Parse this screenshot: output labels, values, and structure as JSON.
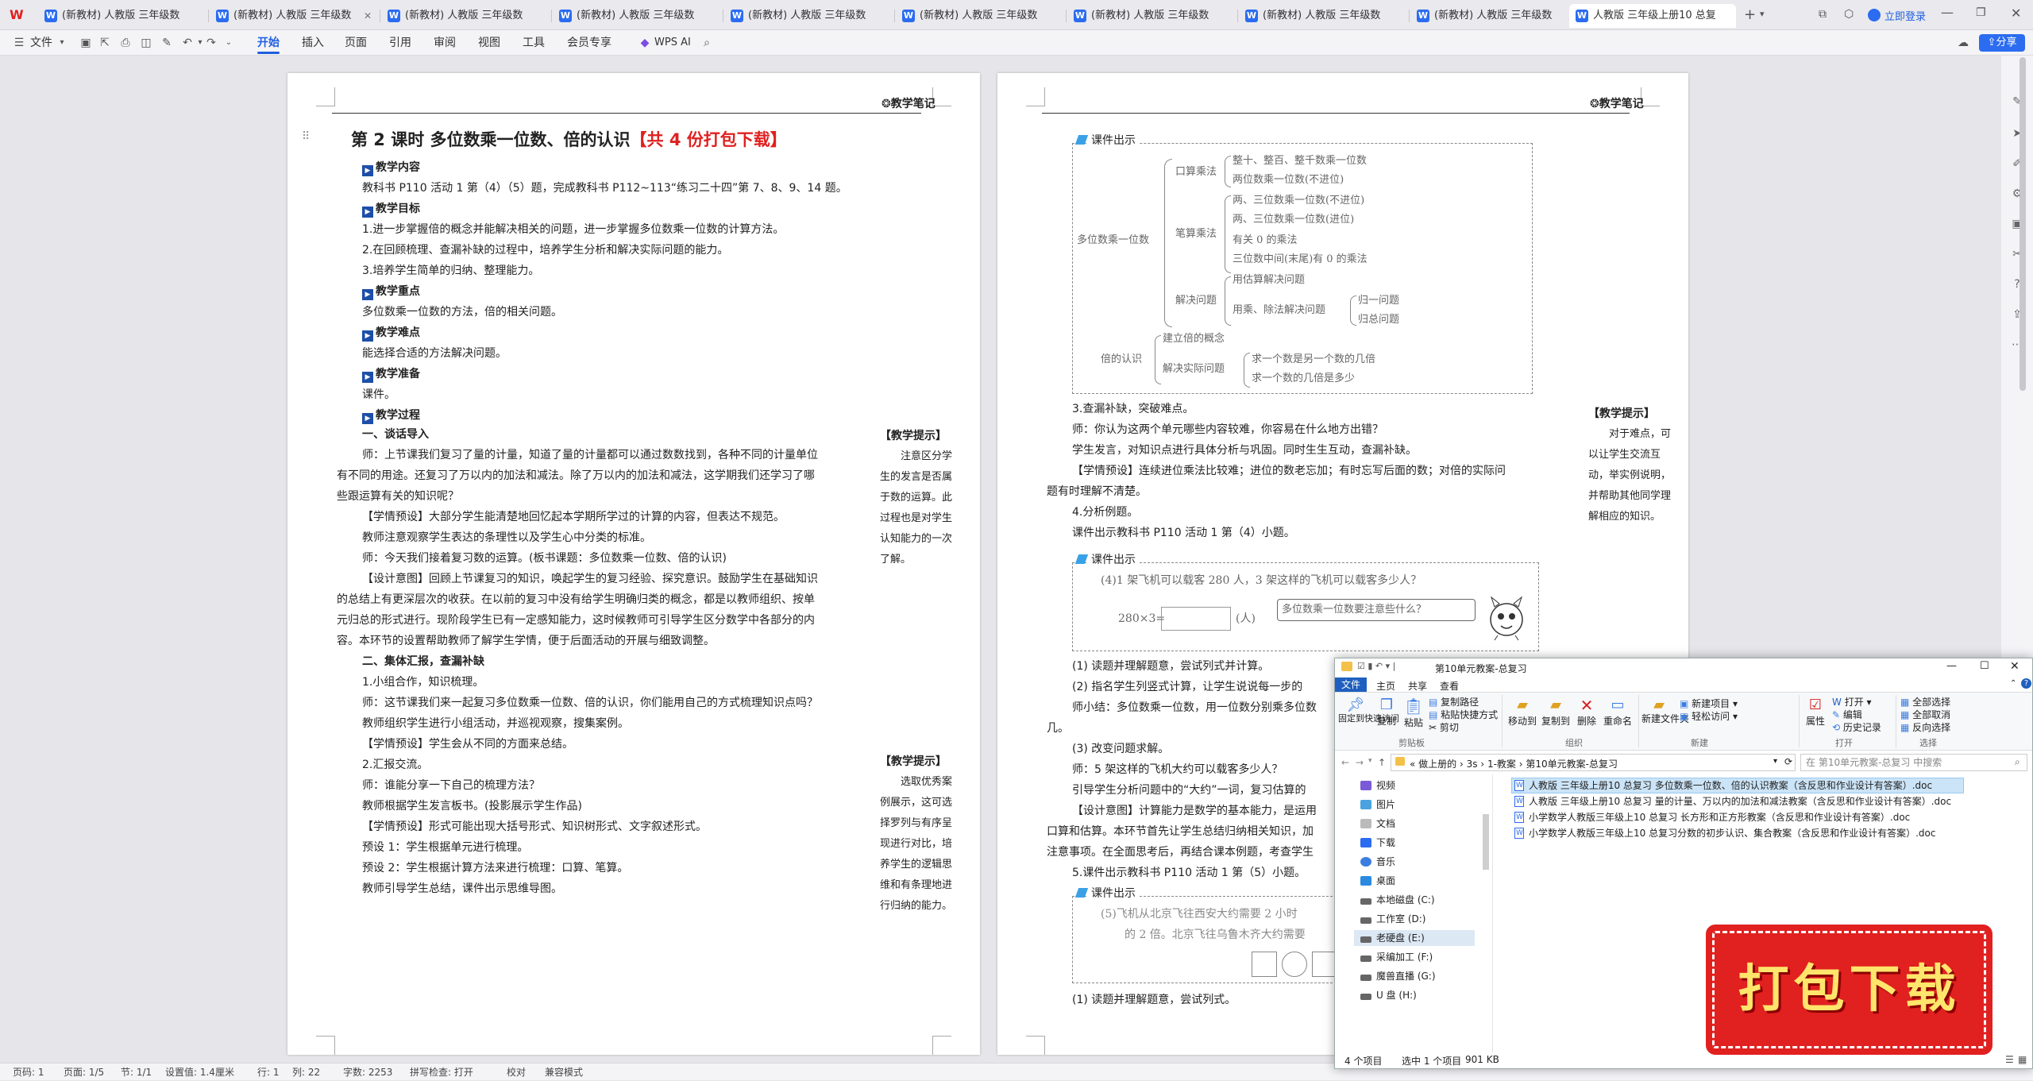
{
  "tabs": [
    {
      "label": "(新教材) 人教版 三年级数"
    },
    {
      "label": "(新教材) 人教版 三年级数"
    },
    {
      "label": "(新教材) 人教版 三年级数"
    },
    {
      "label": "(新教材) 人教版 三年级数"
    },
    {
      "label": "(新教材) 人教版 三年级数"
    },
    {
      "label": "(新教材) 人教版 三年级数"
    },
    {
      "label": "(新教材) 人教版 三年级数"
    },
    {
      "label": "(新教材) 人教版 三年级数"
    },
    {
      "label": "(新教材) 人教版 三年级数"
    },
    {
      "label": "人教版 三年级上册10 总复"
    }
  ],
  "login_label": "立即登录",
  "share_label": "分享",
  "toolbar": {
    "file": "文件",
    "start": "开始",
    "insert": "插入",
    "page": "页面",
    "ref": "引用",
    "review": "审阅",
    "view": "视图",
    "tools": "工具",
    "member": "会员专享",
    "wpsai": "WPS AI"
  },
  "left_page": {
    "title": "第 2 课时  多位数乘一位数、倍的认识",
    "title_red": "【共 4 份打包下载】",
    "notes_header": "教学笔记",
    "content_label": "教学内容",
    "content_text": "教科书 P110 活动 1 第（4）（5）题，完成教科书 P112~113“练习二十四”第 7、8、9、14 题。",
    "goal_label": "教学目标",
    "goal_1": "1.进一步掌握倍的概念并能解决相关的问题，进一步掌握多位数乘一位数的计算方法。",
    "goal_2": "2.在回顾梳理、查漏补缺的过程中，培养学生分析和解决实际问题的能力。",
    "goal_3": "3.培养学生简单的归纳、整理能力。",
    "key_label": "教学重点",
    "key_text": "多位数乘一位数的方法，倍的相关问题。",
    "diff_label": "教学难点",
    "diff_text": "能选择合适的方法解决问题。",
    "prep_label": "教学准备",
    "prep_text": "课件。",
    "proc_label": "教学过程",
    "s1": "一、谈话导入",
    "p1a": "师：上节课我们复习了量的计量，知道了量的计量都可以通过数数找到，各种不同的计量单位",
    "p1b": "有不同的用途。还复习了万以内的加法和减法。除了万以内的加法和减法，这学期我们还学习了哪",
    "p1c": "些跟运算有关的知识呢？",
    "p2": "【学情预设】大部分学生能清楚地回忆起本学期所学过的计算的内容，但表达不规范。",
    "p3": "教师注意观察学生表达的条理性以及学生心中分类的标准。",
    "p4": "师：今天我们接着复习数的运算。(板书课题：多位数乘一位数、倍的认识)",
    "p5a": "【设计意图】回顾上节课复习的知识，唤起学生的复习经验、探究意识。鼓励学生在基础知识",
    "p5b": "的总结上有更深层次的收获。在以前的复习中没有给学生明确归类的概念，都是以教师组织、按单",
    "p5c": "元归总的形式进行。现阶段学生已有一定感知能力，这时候教师可引导学生区分数学中各部分的内",
    "p5d": "容。本环节的设置帮助教师了解学生学情，便于后面活动的开展与细致调整。",
    "s2": "二、集体汇报，查漏补缺",
    "q1": "1.小组合作，知识梳理。",
    "q2": "师：这节课我们来一起复习多位数乘一位数、倍的认识，你们能用自己的方式梳理知识点吗？",
    "q3": "教师组织学生进行小组活动，并巡视观察，搜集案例。",
    "q4": "【学情预设】学生会从不同的方面来总结。",
    "q5": "2.汇报交流。",
    "q6": "师：谁能分享一下自己的梳理方法？",
    "q7": "教师根据学生发言板书。(投影展示学生作品)",
    "q8": "【学情预设】形式可能出现大括号形式、知识树形式、文字叙述形式。",
    "q9": "预设 1：学生根据单元进行梳理。",
    "q10": "预设 2：学生根据计算方法来进行梳理：口算、笔算。",
    "q11": "教师引导学生总结，课件出示思维导图。",
    "tip1_title": "【教学提示】",
    "tip1_text": "注意区分学生的发言是否属于数的运算。此过程也是对学生认知能力的一次了解。",
    "tip2_title": "【教学提示】",
    "tip2_text": "选取优秀案例展示，这可选择罗列与有序呈现进行对比，培养学生的逻辑思维和有条理地进行归纳的能力。"
  },
  "right_page": {
    "notes_header": "教学笔记",
    "ppt_label": "课件出示",
    "mm_root": "多位数乘一位数",
    "mm_kousuan": "口算乘法",
    "mm_k1": "整十、整百、整千数乘一位数",
    "mm_k2": "两位数乘一位数(不进位)",
    "mm_bisuan": "笔算乘法",
    "mm_b1": "两、三位数乘一位数(不进位)",
    "mm_b2": "两、三位数乘一位数(进位)",
    "mm_b3": "有关 0 的乘法",
    "mm_b4": "三位数中间(末尾)有 0 的乘法",
    "mm_jiejue": "解决问题",
    "mm_j1": "用估算解决问题",
    "mm_j2": "用乘、除法解决问题",
    "mm_j2a": "归一问题",
    "mm_j2b": "归总问题",
    "mm_bei": "倍的认识",
    "mm_bei1": "建立倍的概念",
    "mm_bei2": "解决实际问题",
    "mm_bei2a": "求一个数是另一个数的几倍",
    "mm_bei2b": "求一个数的几倍是多少",
    "r1": "3.查漏补缺，突破难点。",
    "r2": "师：你认为这两个单元哪些内容较难，你容易在什么地方出错？",
    "r3": "学生发言，对知识点进行具体分析与巩固。同时生生互动，查漏补缺。",
    "r4a": "【学情预设】连续进位乘法比较难；进位的数老忘加；有时忘写后面的数；对倍的实际问",
    "r4b": "题有时理解不清楚。",
    "r5": "4.分析例题。",
    "r6": "课件出示教科书 P110 活动 1 第（4）小题。",
    "ex4_q": "(4)1 架飞机可以载客 280 人，3 架这样的飞机可以载客多少人？",
    "ex4_eq": "280×3=",
    "ex4_unit": "(人)",
    "ex4_bubble": "多位数乘一位数要注意些什么？",
    "r7": "(1) 读题并理解题意，尝试列式并计算。",
    "r8": "(2) 指名学生列竖式计算，让学生说说每一步的",
    "r9": "师小结：多位数乘一位数，用一位数分别乘多位数",
    "r9b": "几。",
    "r10": "(3) 改变问题求解。",
    "r11": "师：5 架这样的飞机大约可以载客多少人？",
    "r12": "引导学生分析问题中的“大约”一词，复习估算的",
    "r13": "【设计意图】计算能力是数学的基本能力，是运用",
    "r13b": "口算和估算。本环节首先让学生总结归纳相关知识，加",
    "r13c": "注意事项。在全面思考后，再结合课本例题，考查学生",
    "r14": "5.课件出示教科书 P110 活动 1 第（5）小题。",
    "ex5_q1": "(5)飞机从北京飞往西安大约需要 2 小时",
    "ex5_q2": "的 2 倍。北京飞往乌鲁木齐大约需要",
    "r15": "(1) 读题并理解题意，尝试列式。",
    "tip_title": "【教学提示】",
    "tip_text": "对于难点，可以让学生交流互动，举实例说明，并帮助其他同学理解相应的知识。"
  },
  "explorer": {
    "title": "第10单元教案-总复习",
    "tab_file": "文件",
    "tab_home": "主页",
    "tab_share": "共享",
    "tab_view": "查看",
    "btn_pin": "固定到快速访问",
    "btn_copy": "复制",
    "btn_paste": "粘贴",
    "btn_copypath": "复制路径",
    "btn_pasteshortcut": "粘贴快捷方式",
    "btn_cut": "剪切",
    "btn_moveto": "移动到",
    "btn_copyto": "复制到",
    "btn_delete": "删除",
    "btn_rename": "重命名",
    "btn_newfolder": "新建文件夹",
    "btn_newitem": "新建项目",
    "btn_easyaccess": "轻松访问",
    "btn_props": "属性",
    "btn_open": "打开",
    "btn_edit": "编辑",
    "btn_history": "历史记录",
    "btn_selall": "全部选择",
    "btn_selnone": "全部取消",
    "btn_invert": "反向选择",
    "grp_clip": "剪贴板",
    "grp_org": "组织",
    "grp_new": "新建",
    "grp_open": "打开",
    "grp_sel": "选择",
    "path": [
      "做上册的",
      "3s",
      "1-教案",
      "第10单元教案-总复习"
    ],
    "search_placeholder": "在 第10单元教案-总复习 中搜索",
    "nav": [
      "视频",
      "图片",
      "文档",
      "下载",
      "音乐",
      "桌面",
      "本地磁盘 (C:)",
      "工作室 (D:)",
      "老硬盘 (E:)",
      "采编加工 (F:)",
      "魔兽直播 (G:)",
      "U 盘 (H:)"
    ],
    "files": [
      "人教版 三年级上册10 总复习 多位数乘一位数、倍的认识教案（含反思和作业设计有答案）.doc",
      "人教版 三年级上册10 总复习 量的计量、万以内的加法和减法教案（含反思和作业设计有答案）.doc",
      "小学数学人教版三年级上10 总复习 长方形和正方形教案（含反思和作业设计有答案）.doc",
      "小学数学人教版三年级上10 总复习分数的初步认识、集合教案（含反思和作业设计有答案）.doc"
    ],
    "status_count": "4 个项目",
    "status_sel": "选中 1 个项目",
    "status_size": "901 KB"
  },
  "banner_text": "打包下载",
  "statusbar": {
    "page": "页码: 1",
    "pages": "页面: 1/5",
    "section": "节: 1/1",
    "setting": "设置值: 1.4厘米",
    "row": "行: 1",
    "col": "列: 22",
    "words": "字数: 2253",
    "spell": "拼写检查: 打开",
    "proof": "校对",
    "compat": "兼容模式"
  }
}
